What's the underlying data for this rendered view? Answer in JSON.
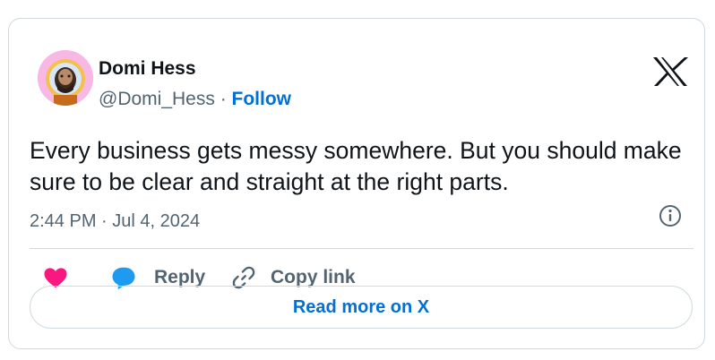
{
  "author": {
    "name": "Domi Hess",
    "handle": "@Domi_Hess",
    "separator": " · ",
    "follow_label": "Follow"
  },
  "tweet": {
    "text": "Every business gets messy somewhere. But you should make sure to be clear and straight at the right parts.",
    "timestamp": "2:44 PM · Jul 4, 2024"
  },
  "actions": {
    "reply_label": "Reply",
    "copy_link_label": "Copy link"
  },
  "footer": {
    "read_more_label": "Read more on X"
  },
  "icons": {
    "brand_logo": "x-logo-icon",
    "info": "info-icon",
    "like": "heart-icon",
    "reply": "speech-bubble-icon",
    "copy_link": "link-icon"
  },
  "colors": {
    "text_primary": "#0f1419",
    "text_secondary": "#536471",
    "link_blue": "#006fd6",
    "heart_pink": "#f91880",
    "reply_blue": "#1d9bf0",
    "border": "#cfd9de"
  }
}
